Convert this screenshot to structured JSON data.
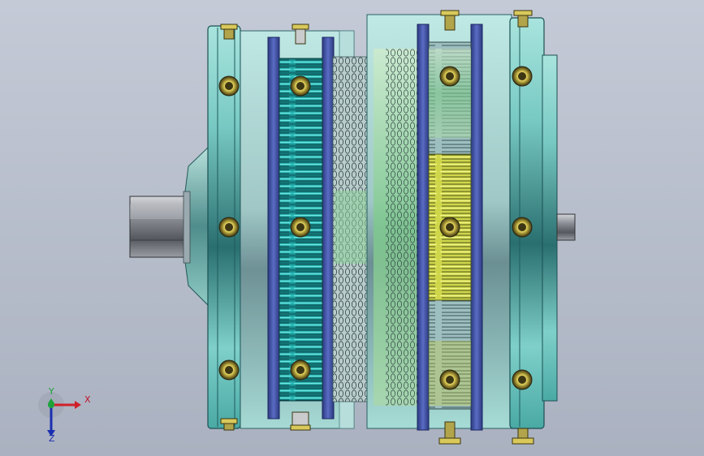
{
  "viewport": {
    "background_top": "#c4cad6",
    "background_bottom": "#aab1c0"
  },
  "model": {
    "description_hidden": "",
    "colors": {
      "housing": "#2f8f8c",
      "housing_light": "#8fd6d1",
      "shell": "#9fd9d3",
      "blue_plate": "#3e4f9c",
      "gear_cyan": "#1fb3b3",
      "gear_yellow": "#b8c43a",
      "gear_green": "#8fcf98",
      "shaft": "#7a7d84",
      "bolt": "#c7b64a"
    }
  },
  "triad": {
    "x_label": "X",
    "y_label": "Y",
    "z_label": "Z",
    "x_color": "#d0202a",
    "y_color": "#1ea23a",
    "z_color": "#1a2fb0"
  }
}
